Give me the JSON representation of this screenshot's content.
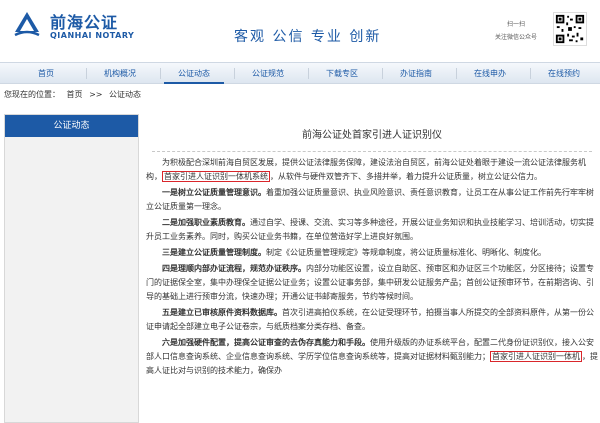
{
  "header": {
    "logo_cn": "前海公证",
    "logo_en": "QIANHAI NOTARY",
    "slogan": "客观 公信 专业 创新",
    "scan_line1": "扫一扫",
    "scan_line2": "关注微信公众号"
  },
  "nav": {
    "items": [
      {
        "label": "首页"
      },
      {
        "label": "机构概况"
      },
      {
        "label": "公证动态"
      },
      {
        "label": "公证规范"
      },
      {
        "label": "下载专区"
      },
      {
        "label": "办证指南"
      },
      {
        "label": "在线申办"
      },
      {
        "label": "在线预约"
      }
    ],
    "active_index": 2
  },
  "breadcrumb": {
    "prefix": "您现在的位置：",
    "home": "首页",
    "sep": ">>",
    "current": "公证动态"
  },
  "sidebar": {
    "title": "公证动态"
  },
  "article": {
    "title": "前海公证处首家引进人证识别仪",
    "p1_a": "为积极配合深圳前海自贸区发展，提供公证法律服务保障，建设法治自贸区，前海公证处着眼于建设一流公证法律服务机构，",
    "p1_hl": "首家引进人证识别一体机系统",
    "p1_b": "，从软件与硬件双管齐下、多措并举，着力提升公证质量，树立公证公信力。",
    "p2_bold": "一是树立公证质量管理意识。",
    "p2_rest": "着重加强公证质量意识、执业风险意识、责任意识教育，让员工在从事公证工作前先行牢牢树立公证质量第一理念。",
    "p3_bold": "二是加强职业素质教育。",
    "p3_rest": "通过自学、授课、交流、实习等多种途径，开展公证业务知识和执业技能学习、培训活动，切实提升员工业务素养。同时，购买公证业务书籍，在单位营造好学上进良好氛围。",
    "p4_bold": "三是建立公证质量管理制度。",
    "p4_rest": "制定《公证质量管理规定》等规章制度，将公证质量标准化、明晰化、制度化。",
    "p5_bold": "四是理顺内部办证流程，规范办证秩序。",
    "p5_rest": "内部分功能区设置，设立自助区、预审区和办证区三个功能区，分区接待；设置专门的证据保全室，集中办理保全证据公证业务；设置公证事务部，集中研发公证服务产品；首创公证预审环节，在前期咨询、引导的基础上进行预审分流，快速办理；开通公证书邮寄服务，节约等候时间。",
    "p6_bold": "五是建立已审核原件资料数据库。",
    "p6_rest": "首次引进高拍仪系统，在公证受理环节，拍摄当事人所提交的全部资料原件，从第一份公证申请起全部建立电子公证卷宗，与纸质档案分类存档、备查。",
    "p7_bold": "六是加强硬件配置，提高公证审查的去伪存真能力和手段。",
    "p7_a": "使用升级版的办证系统平台，配置二代身份证识别仪，接入公安部人口信息查询系统、企业信息查询系统、学历学位信息查询系统等，提高对证据材料甄别能力；",
    "p7_hl": "首家引进人证识别一体机",
    "p7_b": "，提高人证比对与识别的技术能力，确保办"
  },
  "colors": {
    "brand": "#1d5aa6",
    "highlight_border": "#d9262b"
  },
  "icons": {
    "logo": "qianhai-logo-icon",
    "qr": "qr-code-icon"
  }
}
